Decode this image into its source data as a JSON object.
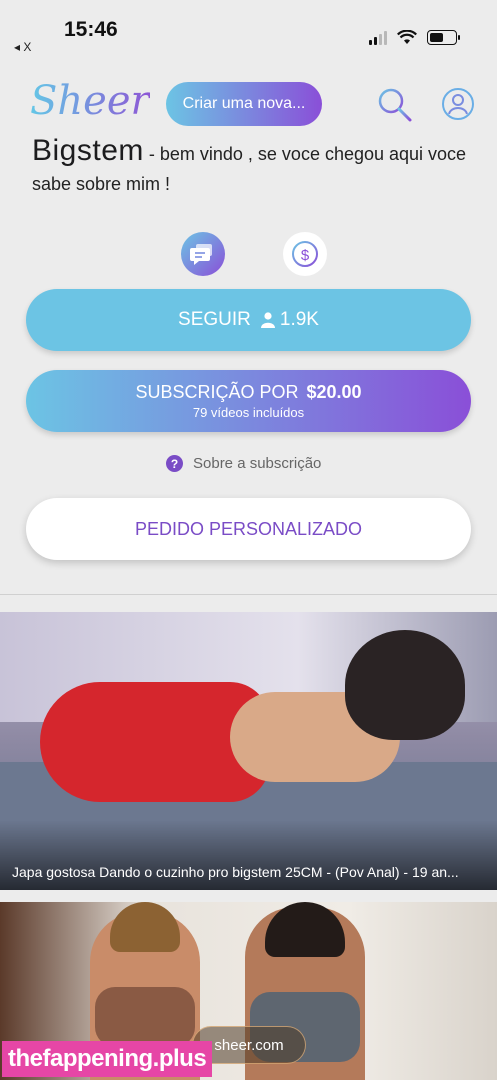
{
  "status_bar": {
    "time": "15:46",
    "back_label": "◂ X",
    "battery_level": 0.55
  },
  "header": {
    "logo": "Sheer",
    "create_button": "Criar uma nova...",
    "icons": [
      "search-icon",
      "profile-icon"
    ],
    "accent_start": "#6cc4e4",
    "accent_end": "#8a4fd8"
  },
  "profile": {
    "name": "Bigstem",
    "bio": " - bem vindo , se voce chegou aqui voce sabe sobre mim !"
  },
  "actions": {
    "icons": [
      "chat-icon",
      "dollar-icon"
    ],
    "follow_label": "SEGUIR",
    "follow_count": "1.9K",
    "subscribe_label": "SUBSCRIÇÃO POR",
    "subscribe_price": "$20.00",
    "subscribe_detail": "79 vídeos incluídos",
    "about_label": "Sobre a subscrição",
    "custom_request_label": "PEDIDO PERSONALIZADO"
  },
  "posts": [
    {
      "caption": "Japa gostosa Dando o cuzinho pro bigstem 25CM - (Pov Anal) - 19 an..."
    },
    {
      "badge": "sheer.com"
    }
  ],
  "watermark": "thefappening.plus"
}
